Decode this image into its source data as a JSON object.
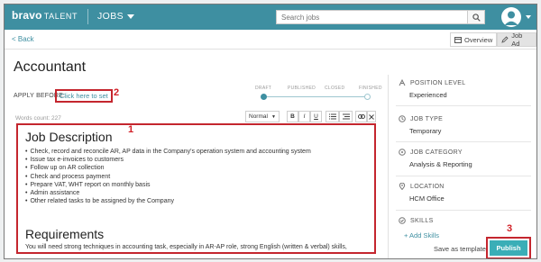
{
  "topbar": {
    "logo_text": "bravo",
    "logo_sub": "TALENT",
    "menu_label": "JOBS",
    "search_placeholder": "Search jobs"
  },
  "subbar": {
    "back_label": "< Back",
    "tabs": [
      {
        "label": "Overview",
        "icon": "overview-icon",
        "active": false
      },
      {
        "label": "Job Ad",
        "icon": "edit-icon",
        "active": true
      }
    ]
  },
  "job": {
    "title": "Accountant",
    "apply_before_label": "APPLY BEFORE:",
    "apply_before_link": "Click here to set"
  },
  "status": {
    "steps": [
      "DRAFT",
      "PUBLISHED",
      "CLOSED",
      "FINISHED"
    ],
    "current": "DRAFT"
  },
  "editor": {
    "words_count": "Words count: 227",
    "toolbar": {
      "format": "Normal",
      "bold": "B",
      "italic": "I",
      "underline": "U"
    },
    "heading_description": "Job Description",
    "bullets": [
      "Check, record and reconcile AR, AP data in the Company's operation system and accounting system",
      "Issue tax e-invoices to customers",
      "Follow up on AR collection",
      "Check and process payment",
      "Prepare VAT, WHT report on monthly basis",
      "Admin assistance",
      "Other related tasks to be assigned by the Company"
    ],
    "heading_requirements": "Requirements",
    "requirements_text": "You will need strong techniques in accounting task, especially in AR-AP role, strong English (written & verbal) skills,"
  },
  "sidebar": {
    "position_level": {
      "label": "POSITION LEVEL",
      "value": "Experienced"
    },
    "job_type": {
      "label": "JOB TYPE",
      "value": "Temporary"
    },
    "job_category": {
      "label": "JOB CATEGORY",
      "value": "Analysis & Reporting"
    },
    "location": {
      "label": "LOCATION",
      "value": "HCM Office"
    },
    "skills": {
      "label": "SKILLS",
      "add_label": "+ Add Skills"
    },
    "save_template": "Save as template",
    "publish": "Publish"
  },
  "annotations": [
    "1",
    "2",
    "3"
  ],
  "colors": {
    "brand": "#3e8fa1",
    "accent": "#3aaeb7",
    "annotation": "#c4262e"
  }
}
